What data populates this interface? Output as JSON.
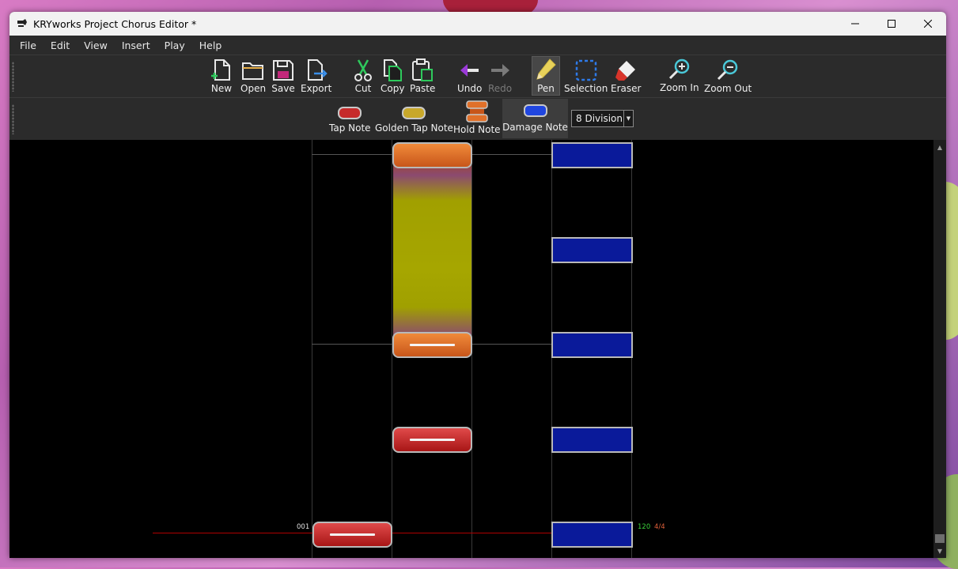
{
  "window": {
    "title": "KRYworks Project Chorus Editor *"
  },
  "menu": [
    "File",
    "Edit",
    "View",
    "Insert",
    "Play",
    "Help"
  ],
  "toolbar": {
    "new": "New",
    "open": "Open",
    "save": "Save",
    "export": "Export",
    "cut": "Cut",
    "copy": "Copy",
    "paste": "Paste",
    "undo": "Undo",
    "redo": "Redo",
    "pen": "Pen",
    "selection": "Selection",
    "eraser": "Eraser",
    "zoom_in": "Zoom In",
    "zoom_out": "Zoom Out"
  },
  "note_toolbar": {
    "tap": "Tap Note",
    "golden_tap": "Golden Tap Note",
    "hold": "Hold Note",
    "damage": "Damage Note",
    "division": "8 Division"
  },
  "chart": {
    "measure": "001",
    "bpm": "120",
    "time_signature": "4/4"
  },
  "colors": {
    "tap_note": "#c62a2a",
    "golden_note": "#c8a82a",
    "hold_note": "#e0702a",
    "damage_note": "#0a1a9a",
    "bpm_text": "#3bd13b",
    "signature_text": "#e0603a"
  }
}
